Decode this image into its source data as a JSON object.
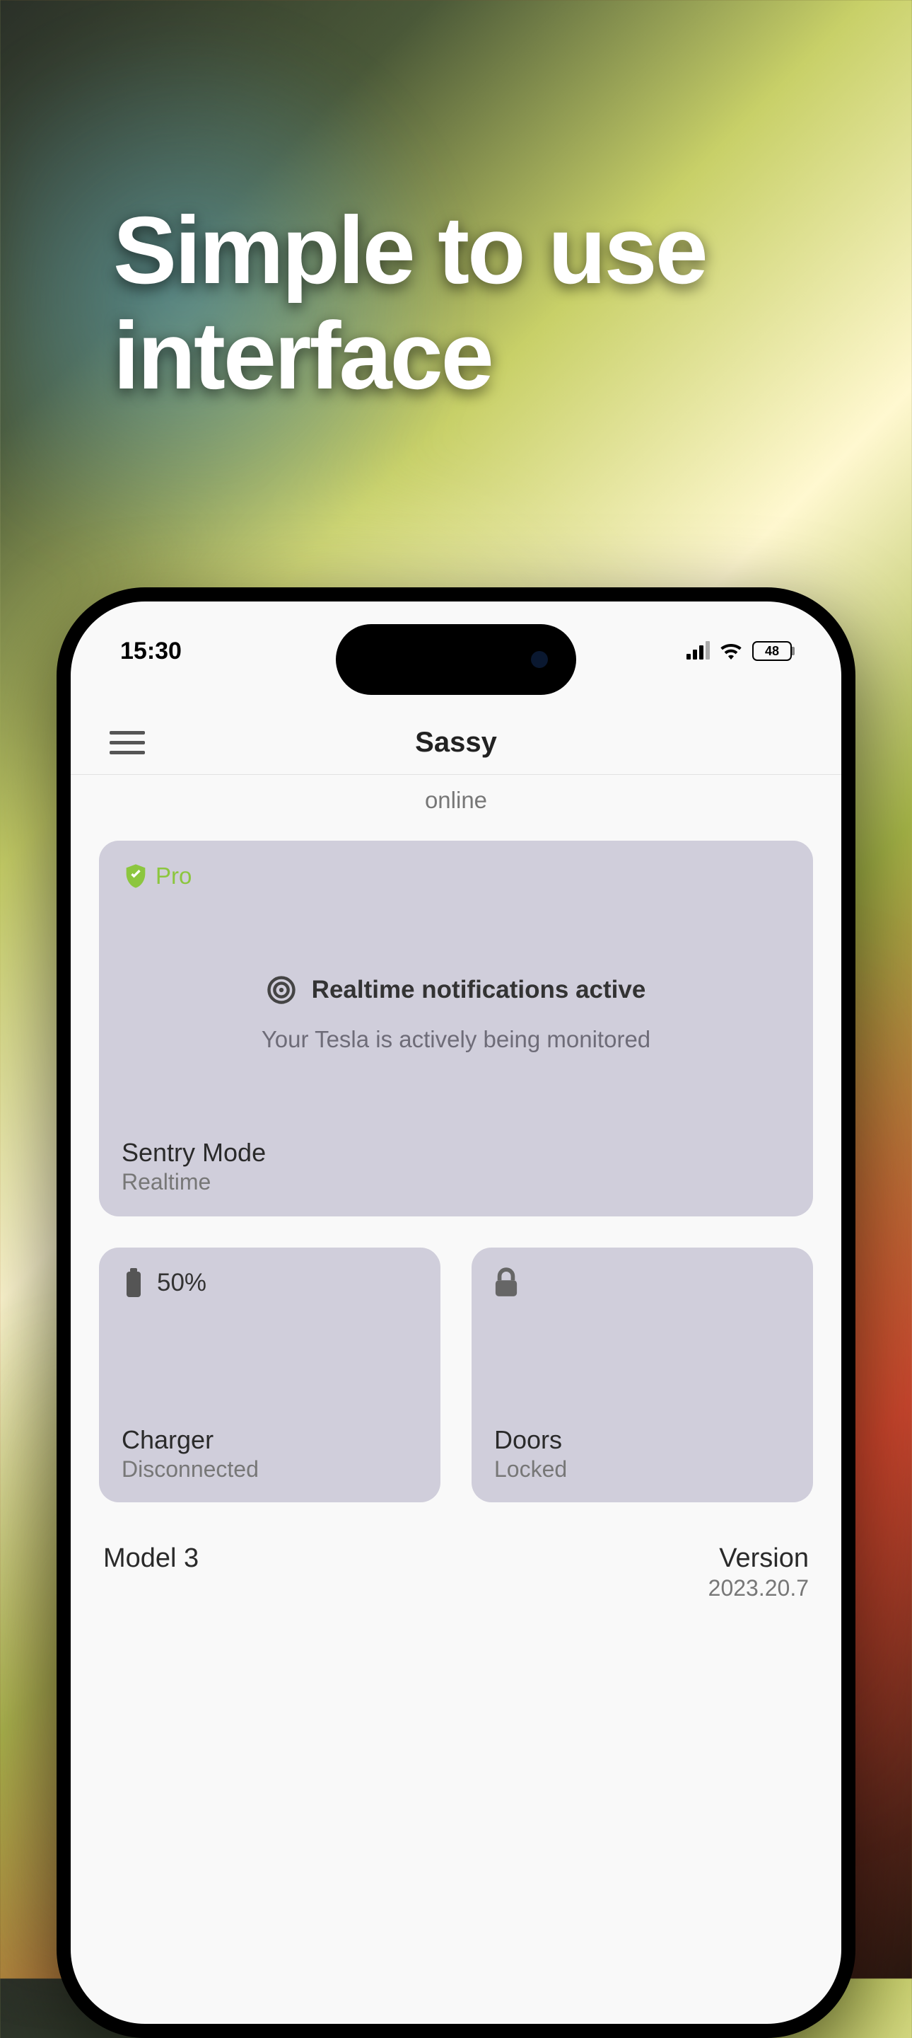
{
  "marketing": {
    "headline": "Simple to use interface"
  },
  "status_bar": {
    "time": "15:30",
    "battery": "48"
  },
  "app": {
    "title": "Sassy",
    "connection_status": "online"
  },
  "sentry_card": {
    "badge": "Pro",
    "headline": "Realtime notifications active",
    "subtitle": "Your Tesla is actively being monitored",
    "footer_title": "Sentry Mode",
    "footer_sub": "Realtime"
  },
  "charger_card": {
    "battery_percent": "50%",
    "title": "Charger",
    "status": "Disconnected"
  },
  "doors_card": {
    "title": "Doors",
    "status": "Locked"
  },
  "vehicle": {
    "model": "Model 3",
    "version_label": "Version",
    "version": "2023.20.7"
  }
}
